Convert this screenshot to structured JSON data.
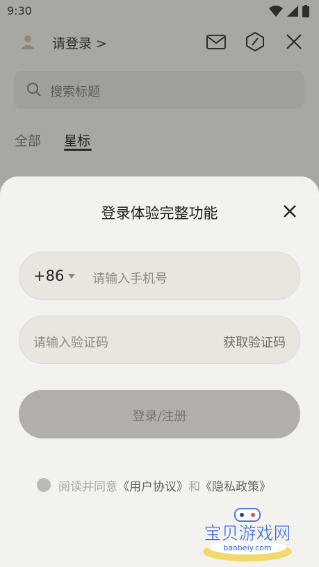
{
  "status_bar": {
    "time": "9:30"
  },
  "header": {
    "login_label": "请登录 >"
  },
  "search": {
    "placeholder": "搜索标题"
  },
  "tabs": [
    {
      "label": "全部"
    },
    {
      "label": "星标"
    }
  ],
  "sheet": {
    "title": "登录体验完整功能",
    "country_code": "+86",
    "phone_placeholder": "请输入手机号",
    "code_placeholder": "请输入验证码",
    "get_code_label": "获取验证码",
    "submit_label": "登录/注册",
    "agree_prefix": "阅读并同意",
    "user_agreement": "《用户协议》",
    "and": "和",
    "privacy_policy": "《隐私政策》"
  },
  "watermark": {
    "title": "宝贝游戏网",
    "url": "baobeiy.com"
  },
  "colors": {
    "sheet_bg": "#f3f2ee",
    "overlay_bg": "#a9a7a2",
    "field_bg": "#e9e6e0",
    "button_disabled": "#b2afaa"
  },
  "icons": [
    "wifi-icon",
    "signal-icon",
    "battery-icon",
    "avatar-icon",
    "mail-icon",
    "hexagon-slash-icon",
    "close-icon",
    "search-icon",
    "caret-down-icon",
    "close-icon"
  ]
}
